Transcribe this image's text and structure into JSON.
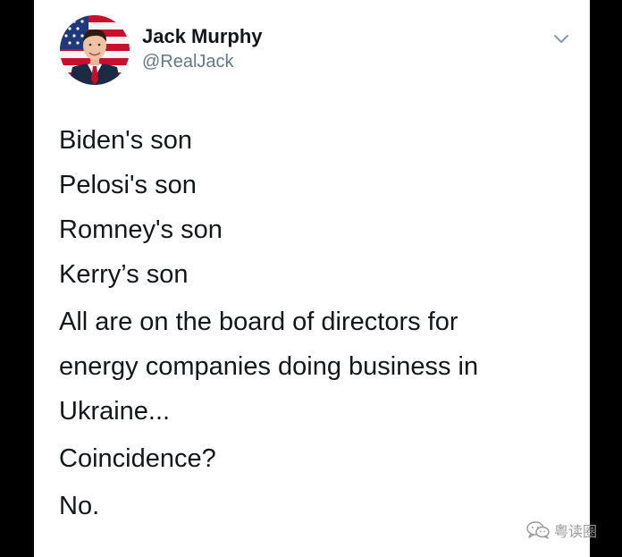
{
  "tweet": {
    "author": {
      "name": "Jack Murphy",
      "handle": "@RealJack"
    },
    "lines": [
      "Biden's son",
      "Pelosi's son",
      "Romney's son",
      "Kerry’s son",
      "All are on the board of directors for",
      "energy companies doing business in",
      "Ukraine...",
      "Coincidence?",
      "No."
    ]
  },
  "watermark": {
    "text": "粤读圈",
    "icon": "wechat-icon"
  },
  "colors": {
    "background": "#000000",
    "card": "#ffffff",
    "text": "#14171a",
    "handle": "#657786"
  }
}
